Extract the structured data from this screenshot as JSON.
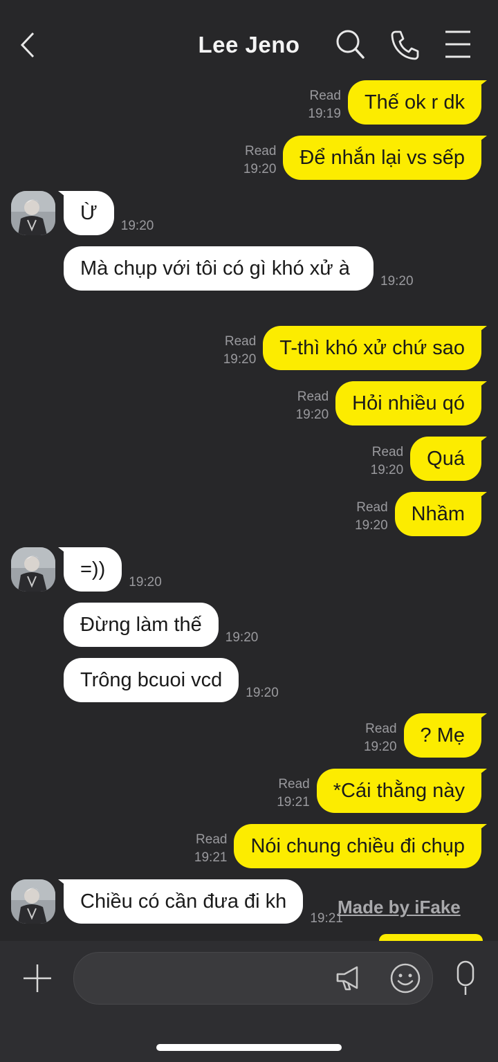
{
  "header": {
    "title": "Lee Jeno"
  },
  "messages": [
    {
      "text": "Thế ok r dk",
      "status": "Read",
      "time": "19:19"
    },
    {
      "text": "Để nhắn lại vs sếp",
      "status": "Read",
      "time": "19:20"
    },
    {
      "text": "Ừ",
      "time": "19:20"
    },
    {
      "text": "Mà chụp với tôi có gì khó xử à",
      "time": "19:20"
    },
    {
      "text": "T-thì khó xử chứ sao",
      "status": "Read",
      "time": "19:20"
    },
    {
      "text": "Hỏi nhiều qó",
      "status": "Read",
      "time": "19:20"
    },
    {
      "text": "Quá",
      "status": "Read",
      "time": "19:20"
    },
    {
      "text": "Nhầm",
      "status": "Read",
      "time": "19:20"
    },
    {
      "text": "=))",
      "time": "19:20"
    },
    {
      "text": "Đừng làm thế",
      "time": "19:20"
    },
    {
      "text": "Trông bcuoi vcd",
      "time": "19:20"
    },
    {
      "text": "? Mẹ",
      "status": "Read",
      "time": "19:20"
    },
    {
      "text": "*Cái thằng này",
      "status": "Read",
      "time": "19:21"
    },
    {
      "text": "Nói chung chiều đi chụp",
      "status": "Read",
      "time": "19:21"
    },
    {
      "text": "Chiều có cần đưa đi kh",
      "time": "19:21"
    }
  ],
  "watermark": "Made by iFake",
  "input": {
    "placeholder": ""
  },
  "colors": {
    "background": "#272729",
    "outgoing_bubble": "#fcec00",
    "incoming_bubble": "#ffffff",
    "meta_text": "#9a9a9e"
  },
  "icons": [
    "back-arrow-icon",
    "search-icon",
    "phone-icon",
    "menu-icon",
    "plus-icon",
    "megaphone-icon",
    "emoji-icon",
    "microphone-icon"
  ]
}
